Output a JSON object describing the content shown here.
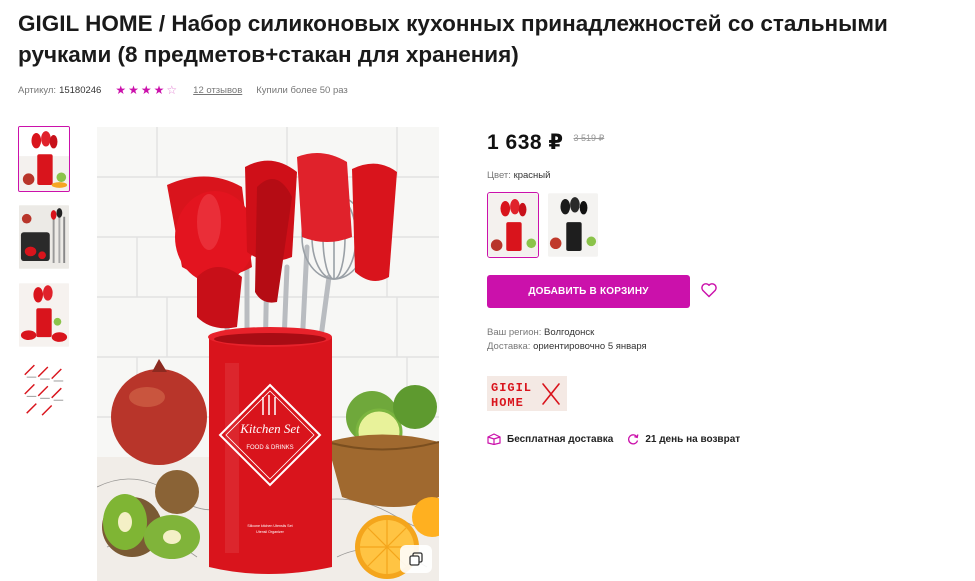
{
  "product": {
    "title": "GIGIL HOME / Набор силиконовых кухонных принадлежностей со стальными ручками (8 предметов+стакан для хранения)",
    "sku_label": "Артикул:",
    "sku_value": "15180246",
    "rating": 4,
    "rating_max": 5,
    "reviews": "12 отзывов",
    "bought": "Купили более 50 раз"
  },
  "gallery": {
    "thumbnails": [
      {
        "icon": "utensil-set-red-thumb"
      },
      {
        "icon": "utensils-laid-out-thumb"
      },
      {
        "icon": "utensil-set-red-alt-thumb"
      },
      {
        "icon": "utensil-diagram-thumb"
      }
    ],
    "main_image": {
      "jar_title": "Kitchen Set",
      "jar_subtitle": "FOOD & DRINKS",
      "jar_small_1": "Silicone kitchen Utensils Set",
      "jar_small_2": "Utensil Organizer"
    }
  },
  "pricing": {
    "price": "1 638 ",
    "currency": "₽",
    "old_price": "3 519 ₽"
  },
  "color": {
    "label": "Цвет:",
    "value": "красный",
    "options": [
      "red",
      "black"
    ]
  },
  "actions": {
    "add_to_cart": "ДОБАВИТЬ В КОРЗИНУ"
  },
  "delivery": {
    "region_label": "Ваш регион:",
    "region_value": "Волгодонск",
    "delivery_label": "Доставка:",
    "delivery_value": "ориентировочно 5 января"
  },
  "brand": {
    "line1": "GIGIL",
    "line2": "HOME"
  },
  "perks": {
    "free_delivery": "Бесплатная доставка",
    "returns": "21 день на возврат"
  },
  "colors": {
    "accent": "#cb11ab",
    "red": "#d9141c"
  }
}
